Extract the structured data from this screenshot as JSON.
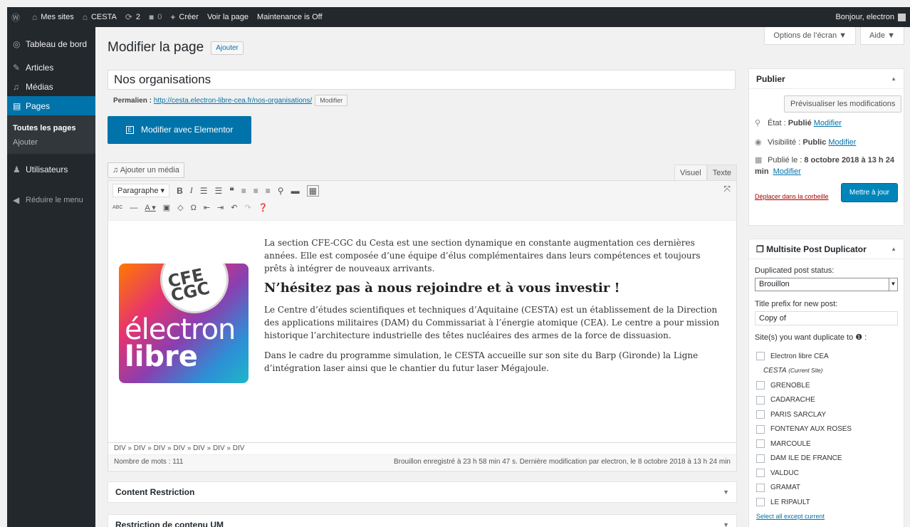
{
  "adminbar": {
    "my_sites": "Mes sites",
    "site": "CESTA",
    "updates": "2",
    "comments": "0",
    "create": "Créer",
    "view_page": "Voir la page",
    "maintenance": "Maintenance is Off",
    "greeting": "Bonjour, electron"
  },
  "sidebar": {
    "items": [
      {
        "label": "Tableau de bord",
        "icon": "dashboard-icon"
      },
      {
        "label": "Articles",
        "icon": "pin-icon"
      },
      {
        "label": "Médias",
        "icon": "media-icon"
      },
      {
        "label": "Pages",
        "icon": "pages-icon"
      }
    ],
    "sub": [
      "Toutes les pages",
      "Ajouter"
    ],
    "users": "Utilisateurs",
    "collapse": "Réduire le menu"
  },
  "screen": {
    "options": "Options de l’écran ▼",
    "help": "Aide ▼"
  },
  "page": {
    "heading": "Modifier la page",
    "add_new": "Ajouter",
    "title_value": "Nos organisations",
    "permalink_label": "Permalien :",
    "permalink_url": "http://cesta.electron-libre-cea.fr/nos-organisations/",
    "permalink_edit": "Modifier",
    "elementor": "Modifier avec Elementor"
  },
  "editor": {
    "add_media": "Ajouter un média",
    "tab_visual": "Visuel",
    "tab_text": "Texte",
    "format": "Paragraphe",
    "logo": {
      "top": "CFE CGC",
      "line1": "électron",
      "line2": "libre"
    },
    "para1": "La section CFE-CGC du Cesta est une section dynamique en constante augmentation ces dernières années.  Elle est composée d’une équipe d’élus complémentaires dans leurs compétences et toujours prêts à intégrer de nouveaux arrivants.",
    "heading": "N’hésitez pas à nous rejoindre et à vous investir !",
    "para2": "Le Centre d’études scientifiques et techniques d’Aquitaine (CESTA) est un établissement de la Direction des applications militaires (DAM) du Commissariat à l’énergie atomique (CEA). Le centre a pour mission historique l’architecture industrielle des têtes nucléaires des armes de la force de dissuasion.",
    "para3": "Dans le cadre du programme simulation, le CESTA accueille sur son site du Barp (Gironde) la Ligne d’intégration laser ainsi que le chantier du futur laser Mégajoule.",
    "path": "DIV » DIV » DIV » DIV » DIV » DIV » DIV",
    "word_count": "Nombre de mots : 111",
    "draft_saved": "Brouillon enregistré à 23 h 58 min 47 s. Dernière modification par electron, le 8 octobre 2018 à 13 h 24 min"
  },
  "boxes": {
    "content_restriction": "Content Restriction",
    "restriction_um": "Restriction de contenu UM"
  },
  "publish": {
    "title": "Publier",
    "preview": "Prévisualiser les modifications",
    "state_label": "État :",
    "state_value": "Publié",
    "visibility_label": "Visibilité :",
    "visibility_value": "Public",
    "published_label": "Publié le :",
    "published_value": "8 octobre 2018 à 13 h 24 min",
    "modify": "Modifier",
    "trash": "Déplacer dans la corbeille",
    "update": "Mettre à jour"
  },
  "duplicator": {
    "title": "Multisite Post Duplicator",
    "status_label": "Duplicated post status:",
    "status_value": "Brouillon",
    "prefix_label": "Title prefix for new post:",
    "prefix_value": "Copy of",
    "sites_label": "Site(s) you want duplicate to",
    "sites": [
      "Electron libre CEA",
      "CESTA",
      "GRENOBLE",
      "CADARACHE",
      "PARIS SARCLAY",
      "FONTENAY AUX ROSES",
      "MARCOULE",
      "DAM ILE DE FRANCE",
      "VALDUC",
      "GRAMAT",
      "LE RIPAULT"
    ],
    "current_note": "(Current Site)",
    "select_all": "Select all except current"
  }
}
